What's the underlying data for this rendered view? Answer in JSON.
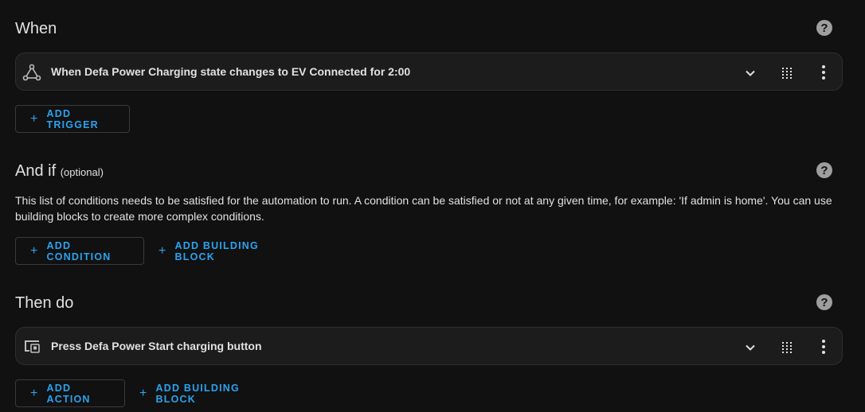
{
  "when": {
    "title": "When",
    "trigger_label": "When Defa Power Charging state changes to EV Connected for 2:00",
    "add_trigger": "ADD TRIGGER"
  },
  "and_if": {
    "title": "And if",
    "optional": "(optional)",
    "description": "This list of conditions needs to be satisfied for the automation to run. A condition can be satisfied or not at any given time, for example: 'If admin is home'. You can use building blocks to create more complex conditions.",
    "add_condition": "ADD CONDITION",
    "add_building_block": "ADD BUILDING BLOCK"
  },
  "then_do": {
    "title": "Then do",
    "action_label": "Press Defa Power Start charging button",
    "add_action": "ADD ACTION",
    "add_building_block": "ADD BUILDING BLOCK"
  },
  "help_glyph": "?",
  "plus_glyph": "+",
  "colors": {
    "background": "#111111",
    "card": "#1c1c1c",
    "accent": "#2aa3f0",
    "text": "#e1e1e1"
  },
  "icons": [
    "help-icon",
    "trigger-graph-icon",
    "chevron-down-icon",
    "drag-handle-icon",
    "more-vert-icon",
    "device-icon",
    "plus-icon"
  ]
}
